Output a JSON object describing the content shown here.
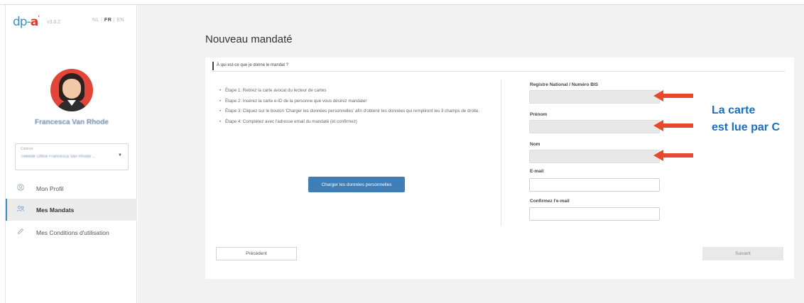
{
  "app": {
    "logo": "dp-a",
    "version": "v3.0.2",
    "languages": [
      "NL",
      "FR",
      "EN"
    ],
    "active_language": "FR"
  },
  "sidebar": {
    "user_name": "Francesca Van Rhode",
    "cabinet_label": "Cabinet",
    "cabinet_value": "Tweede Office Francesca Van Rhode ...",
    "items": [
      {
        "label": "Mon Profil",
        "icon": "user-icon",
        "active": false
      },
      {
        "label": "Mes Mandats",
        "icon": "users-icon",
        "active": true
      },
      {
        "label": "Mes Conditions d'utilisation",
        "icon": "pen-icon",
        "active": false
      }
    ]
  },
  "main": {
    "title": "Nouveau mandaté",
    "section_title": "À qui est-ce que je donne le mandat ?",
    "steps": [
      "Étape 1: Retirez la carte avocat du lecteur de cartes",
      "Étape 2: Insérez la carte e-ID de la personne que vous désirez mandater",
      "Étape 3: Cliquez sur le bouton 'Charger les données personnelles' afin d'obtenir les données qui rempliront les 3 champs de droite.",
      "Étape 4: Complétez avec l'adresse email du mandaté (et confirmez)"
    ],
    "load_button": "Charger les données personnelles",
    "fields": [
      {
        "label": "Registre National / Numéro BIS",
        "value": "",
        "readonly": true
      },
      {
        "label": "Prénom",
        "value": "",
        "readonly": true
      },
      {
        "label": "Nom",
        "value": "",
        "readonly": true
      },
      {
        "label": "E-mail",
        "value": "",
        "readonly": false
      },
      {
        "label": "Confirmez l'e-mail",
        "value": "",
        "readonly": false
      }
    ],
    "prev_button": "Précédent",
    "next_button": "Suivant"
  },
  "annotation": {
    "line1": "La carte",
    "line2": "est lue par C",
    "color": "#1a6fc0",
    "arrow_color": "#e8492c"
  }
}
